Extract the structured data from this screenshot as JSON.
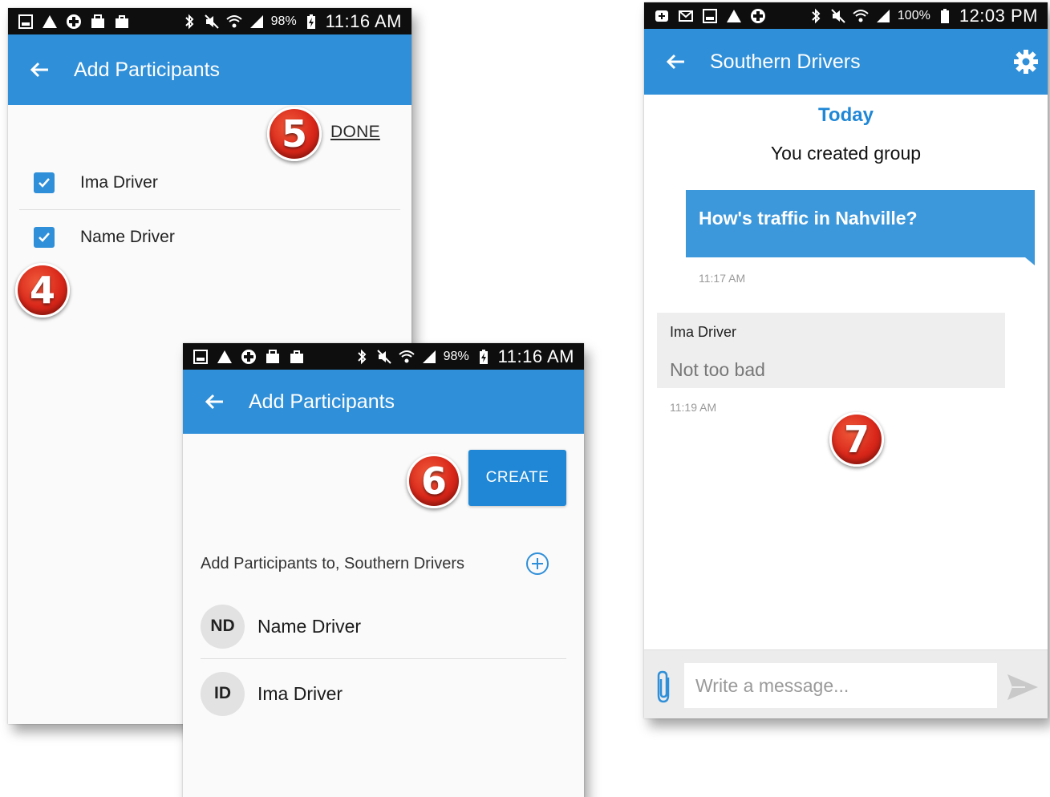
{
  "status_bar_left": {
    "battery_pct": "98%",
    "time": "11:16 AM"
  },
  "status_bar_right": {
    "battery_pct": "100%",
    "time": "12:03 PM"
  },
  "screen1": {
    "title": "Add Participants",
    "done_label": "DONE",
    "contacts": [
      {
        "name": "Ima Driver",
        "checked": true
      },
      {
        "name": "Name Driver",
        "checked": true
      }
    ]
  },
  "screen2": {
    "title": "Add Participants",
    "create_label": "CREATE",
    "section_label": "Add Participants to, Southern Drivers",
    "participants": [
      {
        "initials": "ND",
        "name": "Name Driver"
      },
      {
        "initials": "ID",
        "name": "Ima Driver"
      }
    ]
  },
  "screen3": {
    "title": "Southern Drivers",
    "date_header": "Today",
    "system_message": "You created group",
    "outgoing": {
      "text": "How's traffic in Nahville?",
      "time": "11:17 AM"
    },
    "incoming": {
      "sender": "Ima Driver",
      "text": "Not too bad",
      "time": "11:19 AM"
    },
    "composer_placeholder": "Write a message..."
  },
  "step_badges": {
    "step4": "4",
    "step5": "5",
    "step6": "6",
    "step7": "7"
  },
  "colors": {
    "accent": "#2f8fd8",
    "badge_red": "#d9271a",
    "status_bar": "#0e0e0e"
  }
}
